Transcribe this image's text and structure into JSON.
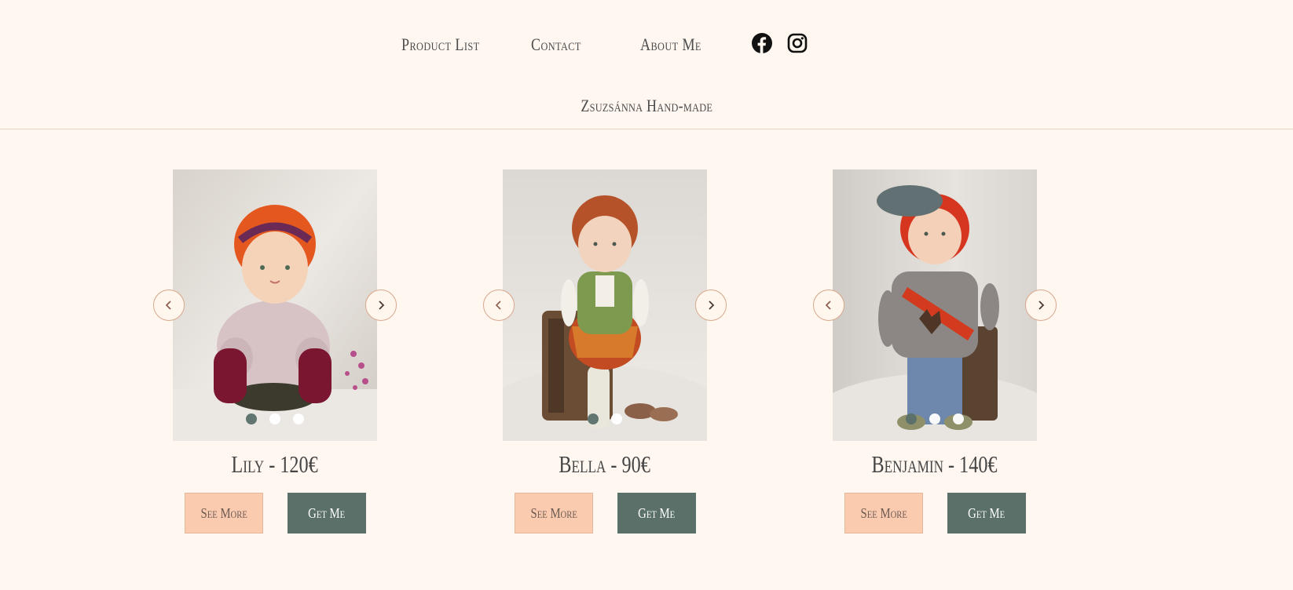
{
  "nav": {
    "items": [
      "Product List",
      "Contact",
      "About Me"
    ],
    "social": [
      "facebook-icon",
      "instagram-icon"
    ]
  },
  "brand": "Zsuzsánna Hand-made",
  "colors": {
    "background": "#fff7f0",
    "accent_dark": "#5a7069",
    "accent_light": "#fbcbb0",
    "arrow_border": "#d9a88c"
  },
  "products": [
    {
      "title": "Lily - 120€",
      "see_more": "See More",
      "get_me": "Get Me",
      "slides": 3,
      "active_slide": 1
    },
    {
      "title": "Bella - 90€",
      "see_more": "See More",
      "get_me": "Get Me",
      "slides": 2,
      "active_slide": 1
    },
    {
      "title": "Benjamin - 140€",
      "see_more": "See More",
      "get_me": "Get Me",
      "slides": 3,
      "active_slide": 1
    }
  ]
}
